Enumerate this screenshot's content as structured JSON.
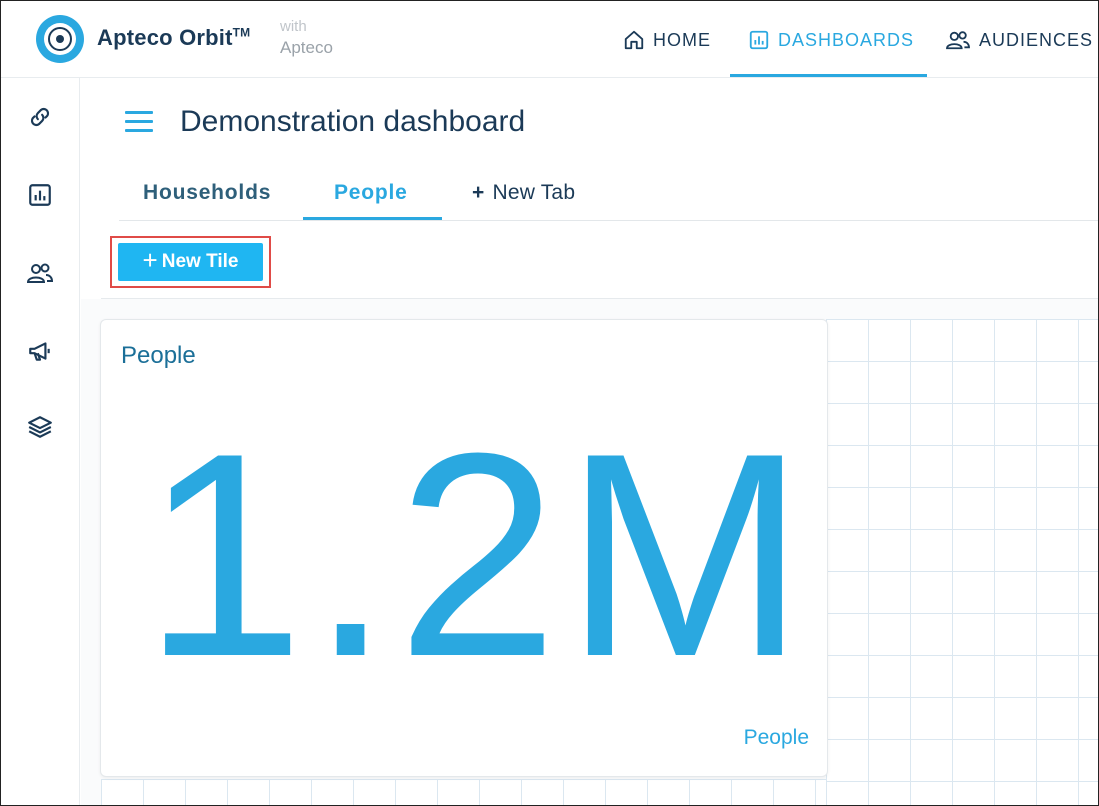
{
  "brand": {
    "name": "Apteco Orbit",
    "tm": "TM",
    "with_label": "with",
    "with_company": "Apteco"
  },
  "nav": {
    "home": "HOME",
    "dashboards": "DASHBOARDS",
    "audiences": "AUDIENCES",
    "active": "DASHBOARDS"
  },
  "sidebar": {
    "items": [
      {
        "icon": "link-icon"
      },
      {
        "icon": "chart-icon"
      },
      {
        "icon": "people-icon"
      },
      {
        "icon": "megaphone-icon"
      },
      {
        "icon": "layers-icon"
      }
    ]
  },
  "page": {
    "title": "Demonstration dashboard"
  },
  "tabs": {
    "items": [
      {
        "label": "Households"
      },
      {
        "label": "People",
        "active": true
      }
    ],
    "new_tab_plus": "+",
    "new_tab_label": "New Tab"
  },
  "toolbar": {
    "new_tile_plus": "+",
    "new_tile_label": "New Tile"
  },
  "tile": {
    "title": "People",
    "value": "1.2M",
    "footer": "People"
  },
  "colors": {
    "accent": "#2aa8e0",
    "navy": "#1b3a57",
    "button": "#1fb6f2",
    "highlight": "#e04b47"
  }
}
